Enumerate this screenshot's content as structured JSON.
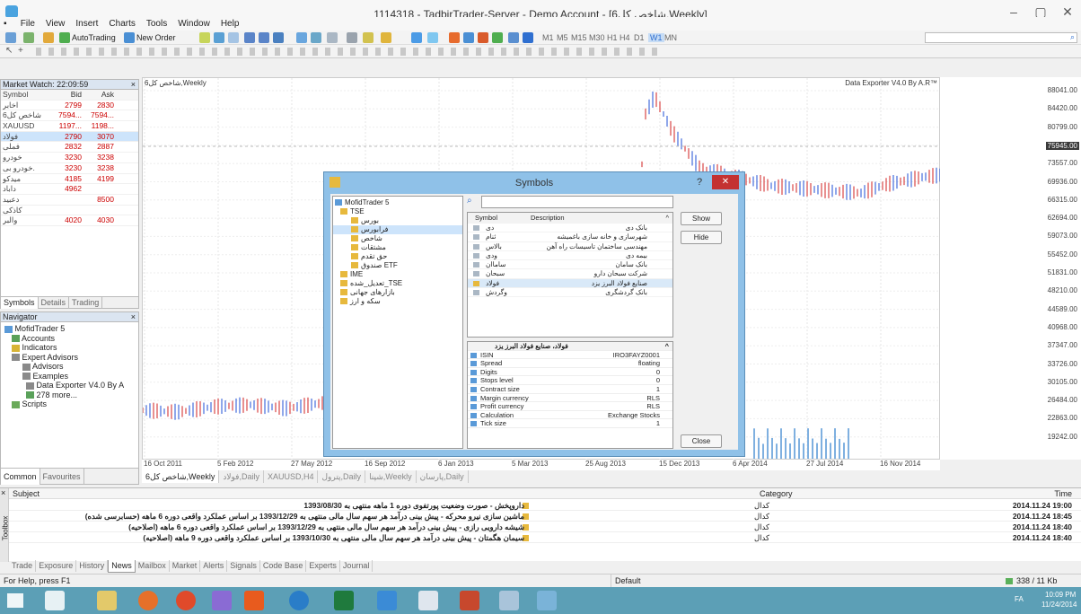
{
  "window": {
    "title": "1114318 - TadbirTrader-Server - Demo Account - [شاخص کل6,Weekly]"
  },
  "menu": [
    "File",
    "View",
    "Insert",
    "Charts",
    "Tools",
    "Window",
    "Help"
  ],
  "toolbar": {
    "autotrading": "AutoTrading",
    "new_order": "New Order",
    "timeframes": [
      "M1",
      "M5",
      "M15",
      "M30",
      "H1",
      "H4",
      "D1",
      "W1",
      "MN"
    ]
  },
  "market_watch": {
    "title": "Market Watch: 22:09:59",
    "headers": [
      "Symbol",
      "Bid",
      "Ask"
    ],
    "rows": [
      {
        "symbol": "اخابر",
        "bid": "2799",
        "ask": "2830"
      },
      {
        "symbol": "شاخص کل6",
        "bid": "7594...",
        "ask": "7594..."
      },
      {
        "symbol": "XAUUSD",
        "bid": "1197...",
        "ask": "1198..."
      },
      {
        "symbol": "فولاد",
        "bid": "2790",
        "ask": "3070"
      },
      {
        "symbol": "فملی",
        "bid": "2832",
        "ask": "2887"
      },
      {
        "symbol": "خودرو",
        "bid": "3230",
        "ask": "3238"
      },
      {
        "symbol": "خودرو بی.",
        "bid": "3230",
        "ask": "3238"
      },
      {
        "symbol": "میدکو",
        "bid": "4185",
        "ask": "4199"
      },
      {
        "symbol": "داباد",
        "bid": "4962",
        "ask": ""
      },
      {
        "symbol": "دعبید",
        "bid": "",
        "ask": "8500"
      },
      {
        "symbol": "کاذکی",
        "bid": "",
        "ask": ""
      },
      {
        "symbol": "والبر",
        "bid": "4020",
        "ask": "4030"
      }
    ],
    "tabs": [
      "Symbols",
      "Details",
      "Trading"
    ]
  },
  "navigator": {
    "title": "Navigator",
    "items": [
      "MofidTrader 5",
      "Accounts",
      "Indicators",
      "Expert Advisors",
      "Advisors",
      "Examples",
      "Data Exporter V4.0 By A",
      "278 more...",
      "Scripts"
    ],
    "tabs": [
      "Common",
      "Favourites"
    ]
  },
  "chart": {
    "label": "شاخص کل6,Weekly",
    "exporter_label": "Data Exporter V4.0 By A.R™",
    "y_ticks": [
      "88041.00",
      "84420.00",
      "80799.00",
      "77178.00",
      "73557.00",
      "69936.00",
      "66315.00",
      "62694.00",
      "59073.00",
      "55452.00",
      "51831.00",
      "48210.00",
      "44589.00",
      "40968.00",
      "37347.00",
      "33726.00",
      "30105.00",
      "26484.00",
      "22863.00",
      "19242.00"
    ],
    "last_price": "75945.00",
    "x_ticks": [
      "16 Oct 2011",
      "5 Feb 2012",
      "27 May 2012",
      "16 Sep 2012",
      "6 Jan 2013",
      "5 Mar 2013",
      "25 Aug 2013",
      "15 Dec 2013",
      "6 Apr 2014",
      "27 Jul 2014",
      "16 Nov 2014"
    ],
    "tabs": [
      "شاخص کل6,Weekly",
      "فولاد,Daily",
      "XAUUSD,H4",
      "پترول,Daily",
      "شپنا,Weekly",
      "پارسان,Daily"
    ]
  },
  "symbols_dialog": {
    "title": "Symbols",
    "help": "?",
    "tree": [
      "MofidTrader 5",
      "TSE",
      "بورس",
      "فرابورس",
      "شاخص",
      "مشتقات",
      "حق تقدم",
      "صندوق ETF",
      "IME",
      "تعدیل_شده_TSE",
      "بازارهای جهانی",
      "سکه و ارز"
    ],
    "sym_headers": [
      "Symbol",
      "Description"
    ],
    "symbols": [
      {
        "s": "دی",
        "d": "بانک دی"
      },
      {
        "s": "ثنام",
        "d": "شهرسازی و خانه سازی باغمیشه"
      },
      {
        "s": "بالاس",
        "d": "مهندسی ساختمان تاسیسات راه آهن"
      },
      {
        "s": "ودی",
        "d": "بیمه دی"
      },
      {
        "s": "ساماان",
        "d": "بانک سامان"
      },
      {
        "s": "سبحان",
        "d": "شرکت سبحان دارو"
      },
      {
        "s": "فولاد",
        "d": "صنایع فولاد البرز یزد"
      },
      {
        "s": "وگردش",
        "d": "بانک گردشگری"
      }
    ],
    "prop_header": "فولاد، صنایع فولاد البرز یزد",
    "props": [
      {
        "k": "ISIN",
        "v": "IRO3FAYZ0001"
      },
      {
        "k": "Spread",
        "v": "floating"
      },
      {
        "k": "Digits",
        "v": "0"
      },
      {
        "k": "Stops level",
        "v": "0"
      },
      {
        "k": "Contract size",
        "v": "1"
      },
      {
        "k": "Margin currency",
        "v": "RLS"
      },
      {
        "k": "Profit currency",
        "v": "RLS"
      },
      {
        "k": "Calculation",
        "v": "Exchange Stocks"
      },
      {
        "k": "Tick size",
        "v": "1"
      }
    ],
    "show": "Show",
    "hide": "Hide",
    "close": "Close"
  },
  "toolbox": {
    "headers": {
      "subject": "Subject",
      "category": "Category",
      "time": "Time"
    },
    "news": [
      {
        "subject": "داروپخش - صورت وضعیت پورتفوی دوره 1 ماهه منتهی به 1393/08/30",
        "category": "کدال",
        "time": "2014.11.24 19:00"
      },
      {
        "subject": "ماشین سازی نیرو محرکه - پیش بینی درآمد هر سهم سال مالی منتهی به 1393/12/29 بر اساس عملکرد واقعی دوره 6 ماهه (حسابرسی شده)",
        "category": "کدال",
        "time": "2014.11.24 18:45"
      },
      {
        "subject": "شیشه دارویی رازی - پیش بینی درآمد هر سهم سال مالی منتهی به 1393/12/29 بر اساس عملکرد واقعی دوره 6 ماهه (اصلاحیه)",
        "category": "کدال",
        "time": "2014.11.24 18:40"
      },
      {
        "subject": "سیمان هگمتان - پیش بینی درآمد هر سهم سال مالی منتهی به 1393/10/30 بر اساس عملکرد واقعی دوره 9 ماهه (اصلاحیه)",
        "category": "کدال",
        "time": "2014.11.24 18:40"
      }
    ],
    "tabs": [
      "Trade",
      "Exposure",
      "History",
      "News",
      "Mailbox",
      "Market",
      "Alerts",
      "Signals",
      "Code Base",
      "Experts",
      "Journal"
    ],
    "side_label": "Toolbox"
  },
  "status": {
    "help": "For Help, press F1",
    "profile": "Default",
    "traffic": "338 / 11 Kb"
  },
  "taskbar": {
    "time": "10:09 PM",
    "date": "11/24/2014",
    "lang": "FA"
  },
  "colors": {
    "bull": "#1f4fd6",
    "bear": "#d22020",
    "accent": "#4a90c8"
  }
}
